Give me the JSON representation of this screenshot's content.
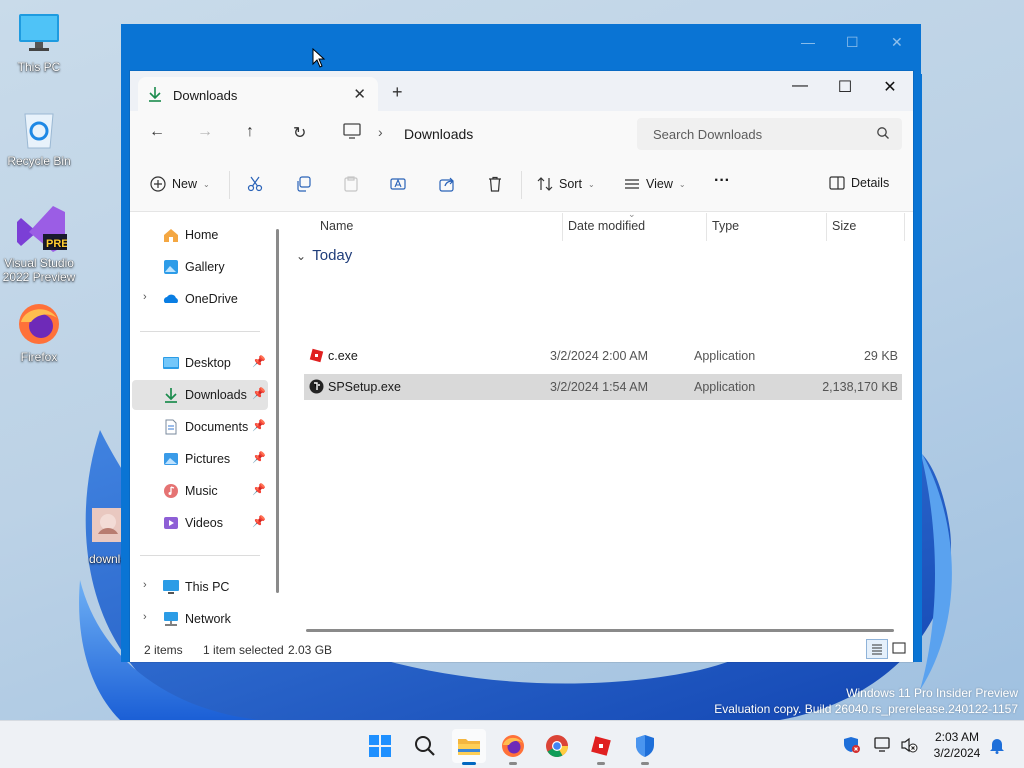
{
  "desktop": {
    "icons": [
      {
        "label": "This PC",
        "icon": "monitor-icon"
      },
      {
        "label": "Recycle Bin",
        "icon": "recycle-bin-icon"
      },
      {
        "label": "Visual Studio 2022 Preview",
        "icon": "visual-studio-icon",
        "badge": "PRE"
      },
      {
        "label": "Firefox",
        "icon": "firefox-icon"
      },
      {
        "label": "downlo",
        "icon": "image-file-icon"
      }
    ],
    "watermark": {
      "line1": "Windows 11 Pro Insider Preview",
      "line2": "Evaluation copy. Build 26040.rs_prerelease.240122-1157"
    }
  },
  "window": {
    "tab_title": "Downloads",
    "new_tab": "+",
    "controls": {
      "minimize": "—",
      "maximize": "☐",
      "close": "✕"
    },
    "breadcrumb": "Downloads",
    "search_placeholder": "Search Downloads",
    "toolbar": {
      "new_label": "New",
      "sort_label": "Sort",
      "view_label": "View",
      "more_label": "···",
      "details_label": "Details"
    },
    "sidebar": {
      "top": [
        {
          "label": "Home",
          "icon": "home-icon"
        },
        {
          "label": "Gallery",
          "icon": "gallery-icon"
        },
        {
          "label": "OneDrive",
          "icon": "onedrive-icon"
        }
      ],
      "pinned": [
        {
          "label": "Desktop",
          "icon": "desktop-folder-icon"
        },
        {
          "label": "Downloads",
          "icon": "downloads-folder-icon",
          "selected": true
        },
        {
          "label": "Documents",
          "icon": "documents-folder-icon"
        },
        {
          "label": "Pictures",
          "icon": "pictures-folder-icon"
        },
        {
          "label": "Music",
          "icon": "music-folder-icon"
        },
        {
          "label": "Videos",
          "icon": "videos-folder-icon"
        }
      ],
      "bottom": [
        {
          "label": "This PC",
          "icon": "this-pc-icon"
        },
        {
          "label": "Network",
          "icon": "network-icon"
        }
      ]
    },
    "columns": {
      "name": "Name",
      "date": "Date modified",
      "type": "Type",
      "size": "Size"
    },
    "group_label": "Today",
    "files": [
      {
        "name": "c.exe",
        "date": "3/2/2024 2:00 AM",
        "type": "Application",
        "size": "29 KB",
        "icon": "roblox-app-icon",
        "selected": false
      },
      {
        "name": "SPSetup.exe",
        "date": "3/2/2024 1:54 AM",
        "type": "Application",
        "size": "2,138,170 KB",
        "icon": "setup-app-icon",
        "selected": true
      }
    ],
    "status": {
      "items": "2 items",
      "selection": "1 item selected",
      "size": "2.03 GB"
    }
  },
  "taskbar": {
    "apps": [
      {
        "name": "start-button"
      },
      {
        "name": "search-button"
      },
      {
        "name": "file-explorer-button"
      },
      {
        "name": "firefox-button"
      },
      {
        "name": "chrome-button"
      },
      {
        "name": "roblox-button"
      },
      {
        "name": "defender-button"
      }
    ],
    "clock": {
      "time": "2:03 AM",
      "date": "3/2/2024"
    }
  }
}
